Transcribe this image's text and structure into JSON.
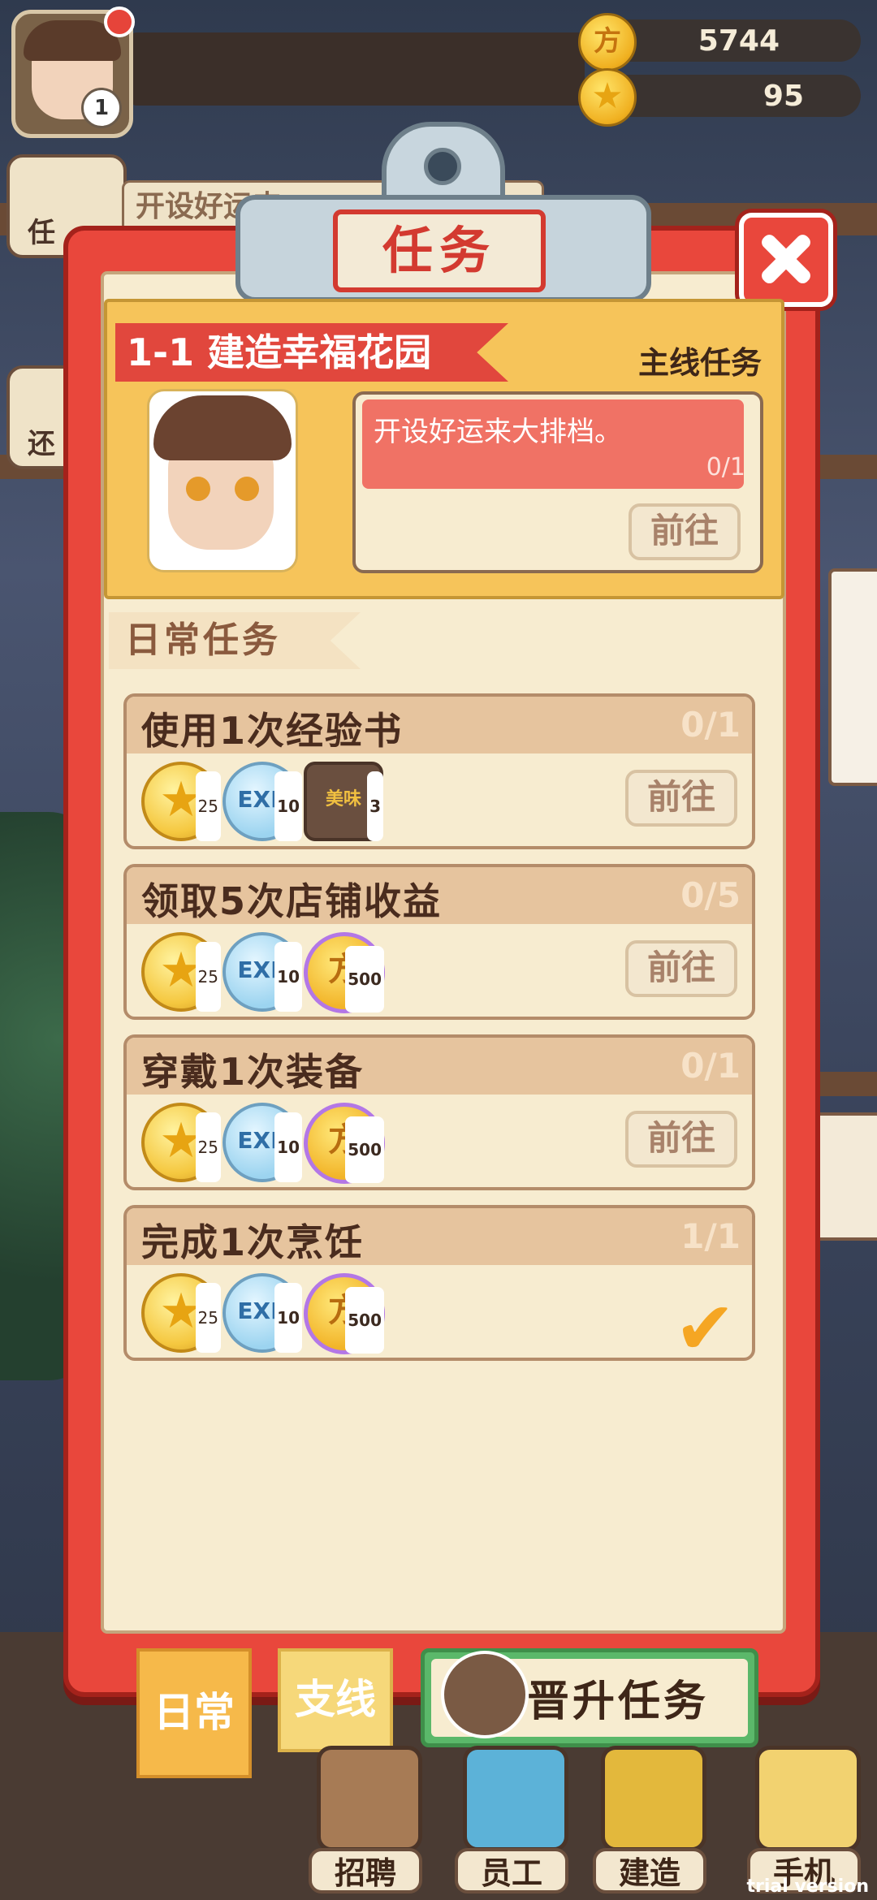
{
  "hud": {
    "coins": "5744",
    "stars": "95",
    "level": "1",
    "coin_glyph": "方",
    "star_glyph": "★"
  },
  "side": {
    "btn1_label": "任",
    "btn2_label": "还",
    "teaser": "开设好运来"
  },
  "panel": {
    "title": "任务"
  },
  "main_quest": {
    "title": "1-1 建造幸福花园",
    "tag": "主线任务",
    "description": "开设好运来大排档。",
    "progress": "0/1",
    "goto_label": "前往"
  },
  "daily_header": "日常任务",
  "tasks": [
    {
      "name": "使用1次经验书",
      "progress": "0/1",
      "goto_label": "前往",
      "rewards": [
        {
          "icon": "star-icon",
          "count": "25"
        },
        {
          "icon": "exp-book-icon",
          "count": "10"
        },
        {
          "icon": "recipe-book-icon",
          "count": "3"
        }
      ]
    },
    {
      "name": "领取5次店铺收益",
      "progress": "0/5",
      "goto_label": "前往",
      "rewards": [
        {
          "icon": "star-icon",
          "count": "25"
        },
        {
          "icon": "exp-book-icon",
          "count": "10"
        },
        {
          "icon": "coin-icon",
          "count": "500"
        }
      ]
    },
    {
      "name": "穿戴1次装备",
      "progress": "0/1",
      "goto_label": "前往",
      "rewards": [
        {
          "icon": "star-icon",
          "count": "25"
        },
        {
          "icon": "exp-book-icon",
          "count": "10"
        },
        {
          "icon": "coin-icon",
          "count": "500"
        }
      ]
    },
    {
      "name": "完成1次烹饪",
      "progress": "1/1",
      "completed": true,
      "rewards": [
        {
          "icon": "star-icon",
          "count": "25"
        },
        {
          "icon": "exp-book-icon",
          "count": "10"
        },
        {
          "icon": "coin-icon",
          "count": "500"
        }
      ]
    }
  ],
  "reward_glyphs": {
    "star": "★",
    "exp": "EXP",
    "book": "美味",
    "coin": "方",
    "check": "✔"
  },
  "tabs": {
    "daily": "日常",
    "branch": "支线",
    "promotion": "晋升任务"
  },
  "nav": {
    "recruit": "招聘",
    "staff": "员工",
    "build": "建造",
    "phone": "手机"
  },
  "watermark": "trial version"
}
